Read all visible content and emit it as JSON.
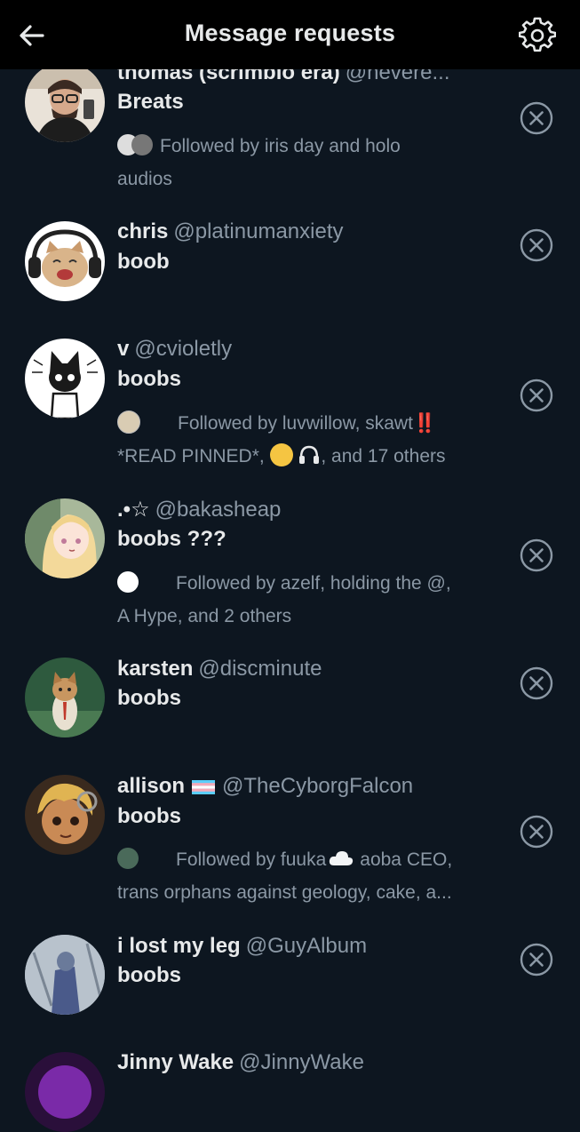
{
  "header": {
    "title": "Message requests",
    "back_icon": "arrow-left-icon",
    "settings_icon": "gear-icon"
  },
  "colors": {
    "background": "#0d1620",
    "header": "#000000",
    "primary_text": "#e7e9ea",
    "secondary_text": "#8b98a5",
    "icon": "#8b98a5",
    "alert": "#f4212e"
  },
  "requests": [
    {
      "name": "thomas (scrimbio era)",
      "handle": "@nevere...",
      "message": "Breats",
      "followed_line1": "Followed by iris day and holo",
      "followed_line2": "audios"
    },
    {
      "name": "chris",
      "handle": "@platinumanxiety",
      "message": "boob"
    },
    {
      "name": "v",
      "handle": "@cvioletly",
      "message": "boobs",
      "followed_line1": "Followed by luvwillow, skawt",
      "followed_badge": "‼️",
      "followed_line2a": "*READ PINNED*,",
      "followed_line2b": ", and 17 others"
    },
    {
      "name": ".•☆",
      "handle": "@bakasheap",
      "message": "boobs ???",
      "followed_line1": "Followed by azelf, holding the @,",
      "followed_line2": "A Hype, and 2 others"
    },
    {
      "name": "karsten",
      "handle": "@discminute",
      "message": "boobs"
    },
    {
      "name": "allison",
      "handle": "@TheCyborgFalcon",
      "message": "boobs",
      "followed_line1a": "Followed by fuuka",
      "followed_line1b": "aoba CEO,",
      "followed_line2": "trans orphans against geology, cake, a..."
    },
    {
      "name": "i lost my leg",
      "handle": "@GuyAlbum",
      "message": "boobs"
    },
    {
      "name": "Jinny Wake",
      "handle": "@JinnyWake"
    }
  ]
}
